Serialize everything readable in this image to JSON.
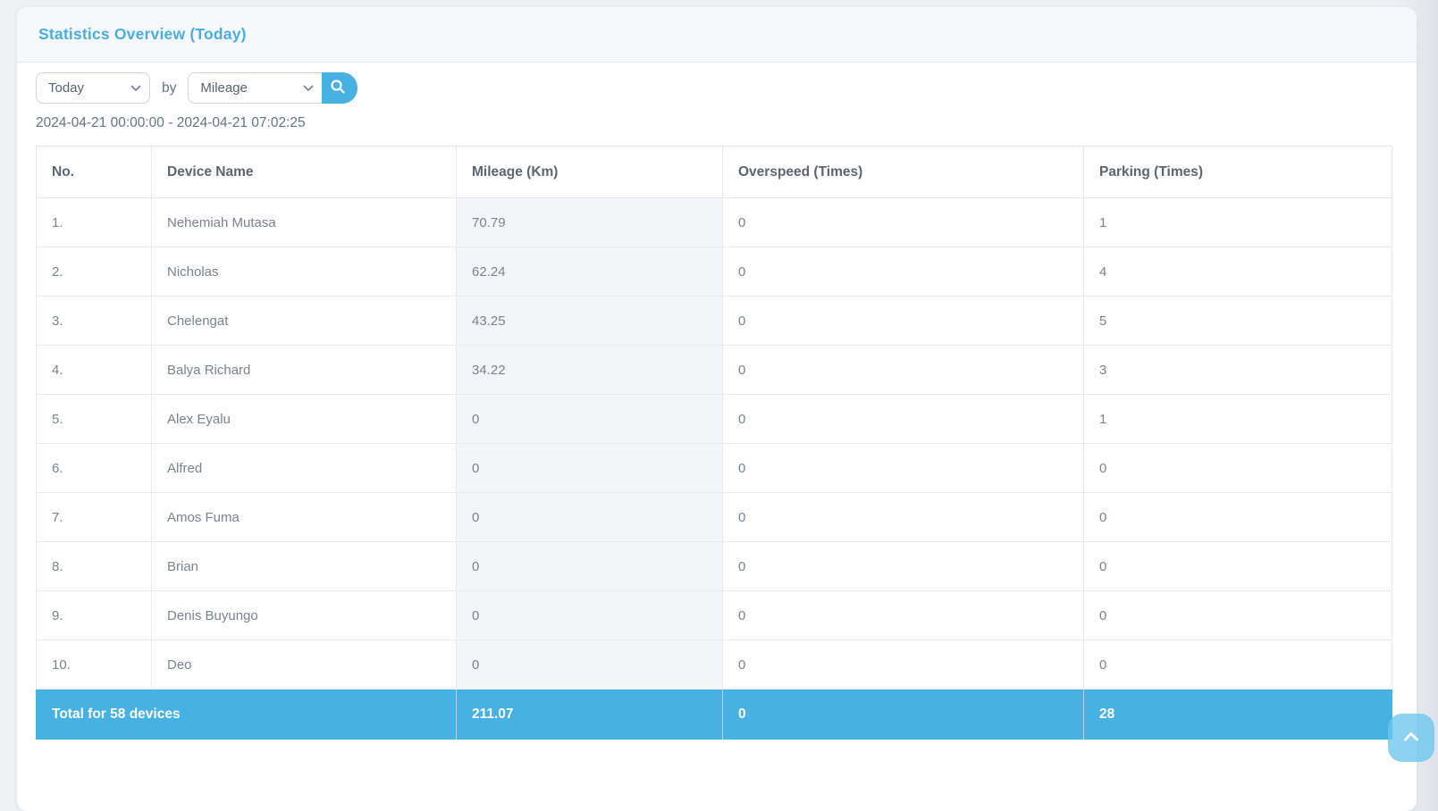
{
  "page": {
    "title": "Statistics Overview (Today)"
  },
  "controls": {
    "period": {
      "value": "Today"
    },
    "by_label": "by",
    "metric": {
      "value": "Mileage"
    },
    "search_button": "search"
  },
  "date_range": "2024-04-21 00:00:00 - 2024-04-21 07:02:25",
  "table": {
    "headers": [
      "No.",
      "Device Name",
      "Mileage (Km)",
      "Overspeed (Times)",
      "Parking (Times)"
    ],
    "rows": [
      {
        "no": "1.",
        "device": "Nehemiah Mutasa",
        "mileage": "70.79",
        "overspeed": "0",
        "parking": "1"
      },
      {
        "no": "2.",
        "device": "Nicholas",
        "mileage": "62.24",
        "overspeed": "0",
        "parking": "4"
      },
      {
        "no": "3.",
        "device": "Chelengat",
        "mileage": "43.25",
        "overspeed": "0",
        "parking": "5"
      },
      {
        "no": "4.",
        "device": "Balya Richard",
        "mileage": "34.22",
        "overspeed": "0",
        "parking": "3"
      },
      {
        "no": "5.",
        "device": "Alex Eyalu",
        "mileage": "0",
        "overspeed": "0",
        "parking": "1"
      },
      {
        "no": "6.",
        "device": "Alfred",
        "mileage": "0",
        "overspeed": "0",
        "parking": "0"
      },
      {
        "no": "7.",
        "device": "Amos Fuma",
        "mileage": "0",
        "overspeed": "0",
        "parking": "0"
      },
      {
        "no": "8.",
        "device": "Brian",
        "mileage": "0",
        "overspeed": "0",
        "parking": "0"
      },
      {
        "no": "9.",
        "device": "Denis Buyungo",
        "mileage": "0",
        "overspeed": "0",
        "parking": "0"
      },
      {
        "no": "10.",
        "device": "Deo",
        "mileage": "0",
        "overspeed": "0",
        "parking": "0"
      }
    ],
    "footer": {
      "label": "Total for 58 devices",
      "mileage": "211.07",
      "overspeed": "0",
      "parking": "28"
    }
  },
  "icons": {
    "search": "search-icon",
    "chevron_down": "chevron-down-icon",
    "chevron_up": "chevron-up-icon"
  },
  "colors": {
    "accent_blue": "#47b1e3",
    "title_blue": "#4aaee2",
    "footer_bg": "#47b1e3",
    "mileage_column_bg": "#f4f5f8",
    "page_bg": "#eef0f4",
    "header_band_bg": "#f7f8fb"
  }
}
